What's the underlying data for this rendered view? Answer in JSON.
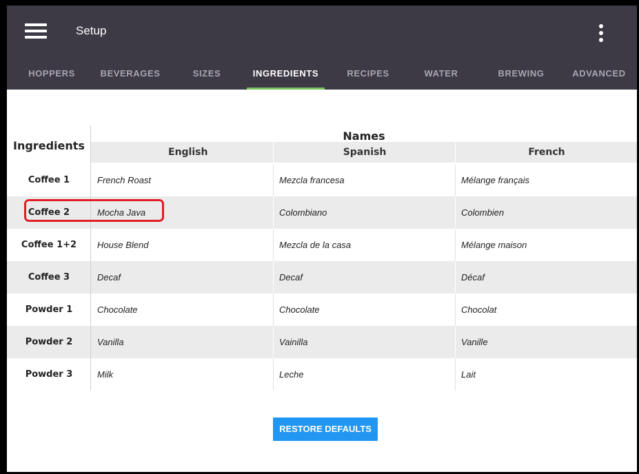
{
  "app": {
    "title": "Setup"
  },
  "tabs": [
    {
      "label": "HOPPERS",
      "active": false
    },
    {
      "label": "BEVERAGES",
      "active": false
    },
    {
      "label": "SIZES",
      "active": false
    },
    {
      "label": "INGREDIENTS",
      "active": true
    },
    {
      "label": "RECIPES",
      "active": false
    },
    {
      "label": "WATER",
      "active": false
    },
    {
      "label": "BREWING",
      "active": false
    },
    {
      "label": "ADVANCED",
      "active": false
    }
  ],
  "table": {
    "row_header": "Ingredients",
    "group_header": "Names",
    "languages": [
      "English",
      "Spanish",
      "French"
    ],
    "rows": [
      {
        "label": "Coffee 1",
        "names": [
          "French Roast",
          "Mezcla francesa",
          "Mélange français"
        ]
      },
      {
        "label": "Coffee 2",
        "names": [
          "Mocha Java",
          "Colombiano",
          "Colombien"
        ]
      },
      {
        "label": "Coffee 1+2",
        "names": [
          "House Blend",
          "Mezcla de la casa",
          "Mélange maison"
        ]
      },
      {
        "label": "Coffee 3",
        "names": [
          "Decaf",
          "Decaf",
          "Décaf"
        ]
      },
      {
        "label": "Powder 1",
        "names": [
          "Chocolate",
          "Chocolate",
          "Chocolat"
        ]
      },
      {
        "label": "Powder 2",
        "names": [
          "Vanilla",
          "Vainilla",
          "Vanille"
        ]
      },
      {
        "label": "Powder 3",
        "names": [
          "Milk",
          "Leche",
          "Lait"
        ]
      }
    ]
  },
  "actions": {
    "restore_label": "RESTORE DEFAULTS"
  },
  "colors": {
    "appbar": "#3d3a46",
    "tab_indicator": "#78c25a",
    "button": "#2196f3",
    "highlight": "#e21c24",
    "row_shade": "#ebebeb"
  }
}
